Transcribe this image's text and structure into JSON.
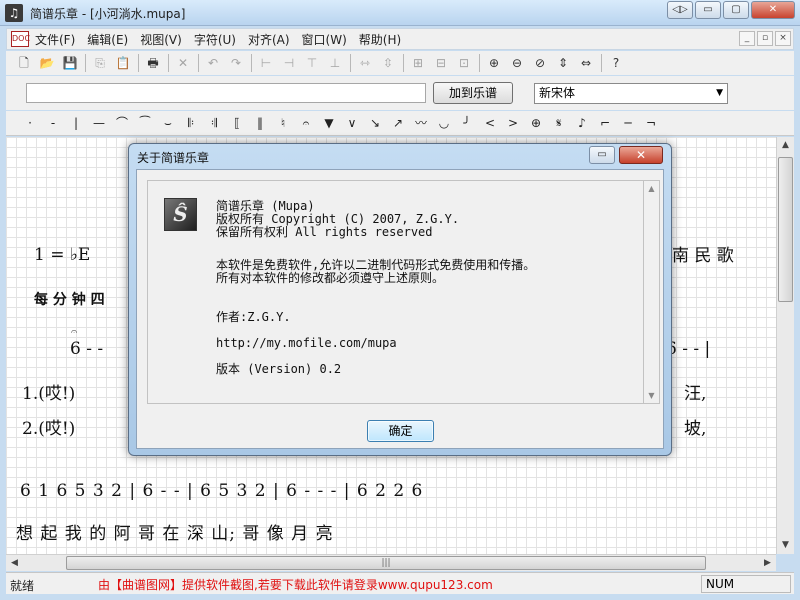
{
  "window": {
    "title": "简谱乐章 - [小河淌水.mupa]",
    "caption_buttons": [
      "◁▷",
      "▭",
      "▢",
      "✕"
    ]
  },
  "menu": {
    "doc_icon": "DOC",
    "items": [
      "文件(F)",
      "编辑(E)",
      "视图(V)",
      "字符(U)",
      "对齐(A)",
      "窗口(W)",
      "帮助(H)"
    ],
    "mdi_buttons": [
      "_",
      "▫",
      "×"
    ]
  },
  "toolbar": {
    "buttons": [
      {
        "name": "new-file-icon",
        "glyph": "🗋",
        "dim": false
      },
      {
        "name": "open-folder-icon",
        "glyph": "📂",
        "dim": false
      },
      {
        "name": "save-icon",
        "glyph": "💾",
        "dim": false
      },
      {
        "sep": true
      },
      {
        "name": "copy-icon",
        "glyph": "⎘",
        "dim": true
      },
      {
        "name": "paste-icon",
        "glyph": "📋",
        "dim": true
      },
      {
        "sep": true
      },
      {
        "name": "print-icon",
        "glyph": "🖶",
        "dim": false
      },
      {
        "sep": true
      },
      {
        "name": "delete-icon",
        "glyph": "✕",
        "dim": true
      },
      {
        "sep": true
      },
      {
        "name": "undo-icon",
        "glyph": "↶",
        "dim": true
      },
      {
        "name": "redo-icon",
        "glyph": "↷",
        "dim": true
      },
      {
        "sep": true
      },
      {
        "name": "align-left-icon",
        "glyph": "⊢",
        "dim": true
      },
      {
        "name": "align-right-icon",
        "glyph": "⊣",
        "dim": true
      },
      {
        "name": "align-top-icon",
        "glyph": "⊤",
        "dim": true
      },
      {
        "name": "align-bottom-icon",
        "glyph": "⊥",
        "dim": true
      },
      {
        "sep": true
      },
      {
        "name": "space-horizontal-icon",
        "glyph": "⇿",
        "dim": true
      },
      {
        "name": "space-vertical-icon",
        "glyph": "⇳",
        "dim": true
      },
      {
        "sep": true
      },
      {
        "name": "group-icon",
        "glyph": "⊞",
        "dim": true
      },
      {
        "name": "ungroup-icon",
        "glyph": "⊟",
        "dim": true
      },
      {
        "name": "frame-icon",
        "glyph": "⊡",
        "dim": true
      },
      {
        "sep": true
      },
      {
        "name": "zoom-in-icon",
        "glyph": "⊕",
        "dim": false
      },
      {
        "name": "zoom-out-icon",
        "glyph": "⊖",
        "dim": false
      },
      {
        "name": "zoom-reset-icon",
        "glyph": "⊘",
        "dim": false
      },
      {
        "name": "fit-height-icon",
        "glyph": "⇕",
        "dim": false
      },
      {
        "name": "fit-width-icon",
        "glyph": "⇔",
        "dim": false
      },
      {
        "sep": true
      },
      {
        "name": "help-icon",
        "glyph": "?",
        "dim": false
      }
    ]
  },
  "inputbar": {
    "text_value": "",
    "add_button": "加到乐谱",
    "font_value": "新宋体"
  },
  "symbols": [
    "·",
    "-",
    "|",
    "—",
    "⌒",
    "⁀",
    "⌣",
    "𝄆",
    "𝄇",
    "⟦",
    "‖",
    "♮",
    "𝄐",
    "▼",
    "∨",
    "↘",
    "↗",
    "〰",
    "◡",
    "╯",
    "<",
    ">",
    "⊕",
    "𝄋",
    "♪",
    "⌐",
    "─",
    "¬"
  ],
  "score": {
    "key": "1 = ♭E",
    "tempo_label": "每 分 钟 四",
    "origin_label": "南 民 歌",
    "fermata_note": "6 - -",
    "lyric_left_1": "1.(哎!)",
    "lyric_left_2": "2.(哎!)",
    "lyric_right_1": "汪,",
    "lyric_right_2": "坡,",
    "right_notes": "6 - - |",
    "notes_line": "6 1  6 5  3 2 | 6 - - |  6 5  3 2  |  6 - - -  |  6 2  2 6",
    "lyrics_line": "想 起 我 的 阿 哥   在        深       山;       哥 像 月 亮"
  },
  "statusbar": {
    "ready": "就绪",
    "notice": "由【曲谱图网】提供软件截图,若要下载此软件请登录www.qupu123.com",
    "num": "NUM"
  },
  "dialog": {
    "title": "关于简谱乐章",
    "icon": "Ŝ",
    "lines": {
      "app": "简谱乐章 (Mupa)",
      "copyright": "版权所有 Copyright (C) 2007, Z.G.Y.",
      "rights": "保留所有权利 All rights reserved",
      "free1": "本软件是免费软件,允许以二进制代码形式免费使用和传播。",
      "free2": "所有对本软件的修改都必须遵守上述原则。",
      "author": "作者:Z.G.Y.",
      "url": "http://my.mofile.com/mupa",
      "version": "版本 (Version) 0.2"
    },
    "ok_button": "确定",
    "close_glyph": "✕",
    "restore_glyph": "▭"
  }
}
